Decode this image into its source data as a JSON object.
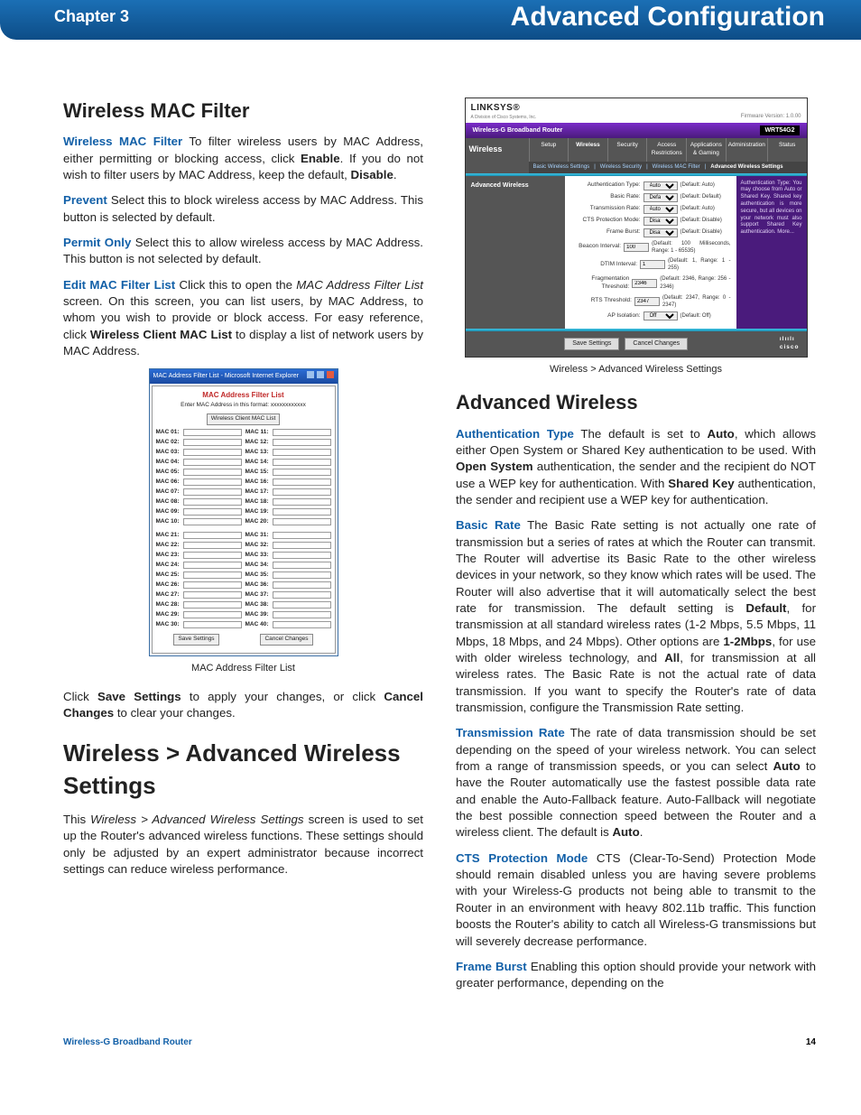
{
  "header": {
    "chapter": "Chapter 3",
    "title": "Advanced Configuration"
  },
  "left": {
    "h_mac": "Wireless MAC Filter",
    "p_mac_intro_term": "Wireless MAC Filter",
    "p_mac_1a": "  To filter wireless users by MAC Address, either permitting or blocking access, click ",
    "p_mac_1b": "Enable",
    "p_mac_1c": ". If you do not wish to filter users by MAC Address, keep the default, ",
    "p_mac_1d": "Disable",
    "p_mac_1e": ".",
    "p_prev_term": "Prevent",
    "p_prev": "  Select this to block wireless access by MAC Address. This button is selected by default.",
    "p_perm_term": "Permit Only",
    "p_perm": "  Select this to allow wireless access by MAC Address. This button is not selected by default.",
    "p_edit_term": "Edit MAC Filter List",
    "p_edit_a": "  Click this to open the ",
    "p_edit_it": "MAC Address Filter List",
    "p_edit_b": " screen. On this screen, you can list users, by MAC Address, to whom you wish to provide or block access. For easy reference, click ",
    "p_edit_bold": "Wireless Client MAC List",
    "p_edit_c": " to display a list of network users by MAC Address.",
    "mac_caption": "MAC Address Filter List",
    "p_save_a": "Click ",
    "p_save_b": "Save Settings",
    "p_save_c": " to apply your changes, or click ",
    "p_save_d": "Cancel Changes",
    "p_save_e": " to clear your changes.",
    "h_adv": "Wireless > Advanced Wireless Settings",
    "p_adv_a": "This ",
    "p_adv_it": "Wireless > Advanced Wireless Settings",
    "p_adv_b": " screen is used to set up the Router's advanced wireless functions. These settings should only be adjusted by an expert administrator because incorrect settings can reduce wireless performance."
  },
  "mac_dialog": {
    "titlebar": "MAC Address Filter List - Microsoft Internet Explorer",
    "heading": "MAC Address Filter List",
    "sub": "Enter MAC Address in this format: xxxxxxxxxxxx",
    "client_btn": "Wireless Client MAC List",
    "labels1": [
      "MAC 01:",
      "MAC 02:",
      "MAC 03:",
      "MAC 04:",
      "MAC 05:",
      "MAC 06:",
      "MAC 07:",
      "MAC 08:",
      "MAC 09:",
      "MAC 10:"
    ],
    "labels1r": [
      "MAC 11:",
      "MAC 12:",
      "MAC 13:",
      "MAC 14:",
      "MAC 15:",
      "MAC 16:",
      "MAC 17:",
      "MAC 18:",
      "MAC 19:",
      "MAC 20:"
    ],
    "labels2": [
      "MAC 21:",
      "MAC 22:",
      "MAC 23:",
      "MAC 24:",
      "MAC 25:",
      "MAC 26:",
      "MAC 27:",
      "MAC 28:",
      "MAC 29:",
      "MAC 30:"
    ],
    "labels2r": [
      "MAC 31:",
      "MAC 32:",
      "MAC 33:",
      "MAC 34:",
      "MAC 35:",
      "MAC 36:",
      "MAC 37:",
      "MAC 38:",
      "MAC 39:",
      "MAC 40:"
    ],
    "save": "Save Settings",
    "cancel": "Cancel Changes"
  },
  "aw": {
    "brand": "LINKSYS®",
    "brand_sub": "A Division of Cisco Systems, Inc.",
    "fw": "Firmware Version: 1.0.00",
    "bar_title": "Wireless-G Broadband Router",
    "model": "WRT54G2",
    "side": "Wireless",
    "tabs": [
      "Setup",
      "Wireless",
      "Security",
      "Access Restrictions",
      "Applications & Gaming",
      "Administration",
      "Status"
    ],
    "subtabs": [
      "Basic Wireless Settings",
      "Wireless Security",
      "Wireless MAC Filter",
      "Advanced Wireless Settings"
    ],
    "section": "Advanced Wireless",
    "rows": [
      {
        "label": "Authentication Type:",
        "sel": "Auto",
        "hint": "(Default: Auto)"
      },
      {
        "label": "Basic Rate:",
        "sel": "Default",
        "hint": "(Default: Default)"
      },
      {
        "label": "Transmission Rate:",
        "sel": "Auto",
        "hint": "(Default: Auto)"
      },
      {
        "label": "CTS Protection Mode:",
        "sel": "Disable",
        "hint": "(Default: Disable)"
      },
      {
        "label": "Frame Burst:",
        "sel": "Disable",
        "hint": "(Default: Disable)"
      },
      {
        "label": "Beacon Interval:",
        "val": "100",
        "hint": "(Default: 100 Milliseconds, Range: 1 - 65535)"
      },
      {
        "label": "DTIM Interval:",
        "val": "1",
        "hint": "(Default: 1, Range: 1 - 255)"
      },
      {
        "label": "Fragmentation Threshold:",
        "val": "2346",
        "hint": "(Default: 2346, Range: 256 - 2346)"
      },
      {
        "label": "RTS Threshold:",
        "val": "2347",
        "hint": "(Default: 2347, Range: 0 - 2347)"
      },
      {
        "label": "AP Isolation:",
        "sel": "Off",
        "hint": "(Default: Off)"
      }
    ],
    "help": "Authentication Type: You may choose from Auto or Shared Key. Shared key authentication is more secure, but all devices on your network must also support Shared Key authentication.\nMore...",
    "save": "Save Settings",
    "cancel": "Cancel Changes",
    "logo": "cisco",
    "caption": "Wireless > Advanced Wireless Settings"
  },
  "right": {
    "h": "Advanced Wireless",
    "auth_term": "Authentication Type",
    "auth_a": "  The default is set to ",
    "auth_b": "Auto",
    "auth_c": ", which allows either Open System or Shared Key authentication to be used. With ",
    "auth_d": "Open System",
    "auth_e": " authentication, the sender and the recipient do NOT use a WEP key for authentication. With ",
    "auth_f": "Shared Key",
    "auth_g": " authentication, the sender and recipient use a WEP key for authentication.",
    "br_term": "Basic Rate",
    "br_a": "  The Basic Rate setting is not actually one rate of transmission but a series of rates at which the Router can transmit. The Router will advertise its Basic Rate to the other wireless devices in your network, so they know which rates will be used. The Router will also advertise that it will automatically select the best rate for transmission. The default setting is ",
    "br_b": "Default",
    "br_c": ", for transmission at all standard wireless rates (1-2 Mbps, 5.5 Mbps, 11 Mbps, 18 Mbps, and 24 Mbps). Other options are ",
    "br_d": "1-2Mbps",
    "br_e": ", for use with older wireless technology, and ",
    "br_f": "All",
    "br_g": ", for transmission at all wireless rates. The Basic Rate is not the actual rate of data transmission. If you want to specify the Router's rate of data transmission, configure the Transmission Rate setting.",
    "tr_term": "Transmission Rate",
    "tr_a": "  The rate of data transmission should be set depending on the speed of your wireless network. You can select from a range of transmission speeds, or you can select ",
    "tr_b": "Auto",
    "tr_c": " to have the Router automatically use the fastest possible data rate and enable the Auto-Fallback feature. Auto-Fallback will negotiate the best possible connection speed between the Router and a wireless client. The default is ",
    "tr_d": "Auto",
    "tr_e": ".",
    "cts_term": "CTS Protection Mode",
    "cts": " CTS (Clear-To-Send) Protection Mode should remain disabled unless you are having severe problems with your Wireless-G products not being able to transmit to the Router in an environment with heavy 802.11b traffic. This function boosts the Router's ability to catch all Wireless-G transmissions but will severely decrease performance.",
    "fb_term": "Frame Burst",
    "fb": "  Enabling this option should provide your network with greater performance, depending on the"
  },
  "footer": {
    "product": "Wireless-G Broadband Router",
    "page": "14"
  }
}
